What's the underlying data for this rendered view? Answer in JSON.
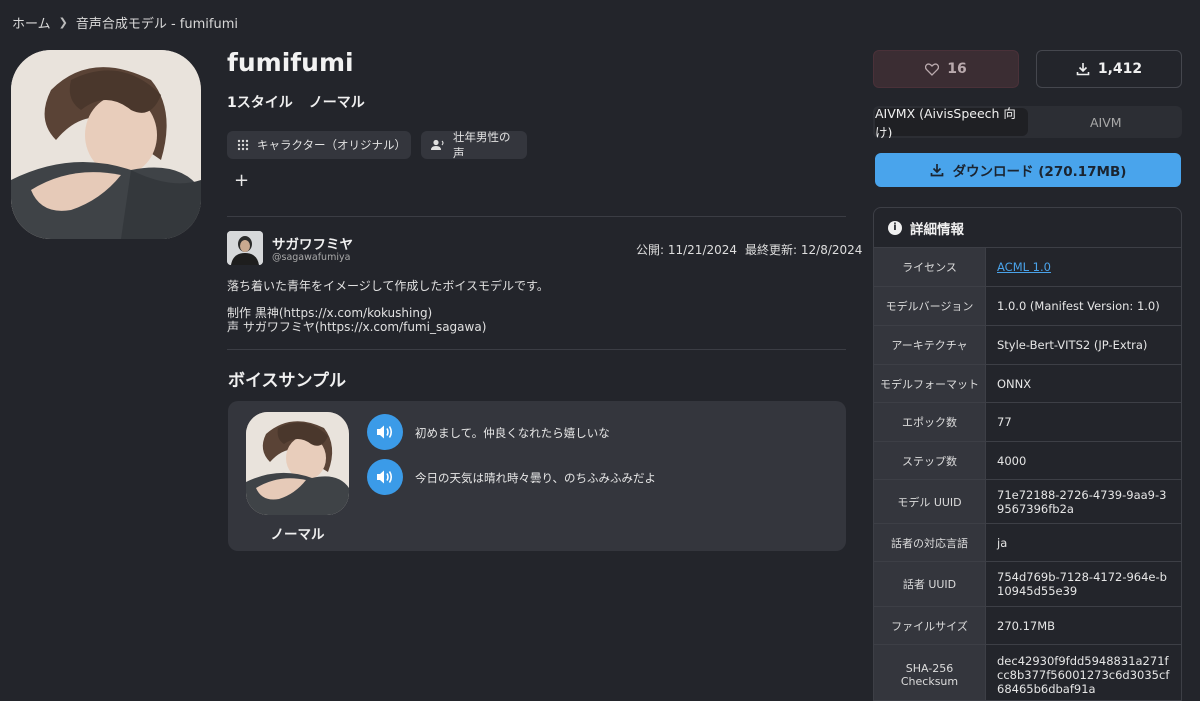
{
  "breadcrumb": {
    "home": "ホーム",
    "current": "音声合成モデル - fumifumi"
  },
  "model": {
    "name": "fumifumi",
    "style_count": "1スタイル",
    "style_name": "ノーマル",
    "tags": [
      "キャラクター（オリジナル）",
      "壮年男性の声"
    ],
    "add_tag": "+"
  },
  "author": {
    "name": "サガワフミヤ",
    "handle": "@sagawafumiya",
    "published": "公開: 11/21/2024",
    "updated": "最終更新: 12/8/2024"
  },
  "description": {
    "line1": "落ち着いた青年をイメージして作成したボイスモデルです。",
    "line2": "制作 黒神(https://x.com/kokushing)",
    "line3": "声 サガワフミヤ(https://x.com/fumi_sagawa)"
  },
  "voice_samples": {
    "title": "ボイスサンプル",
    "style_label": "ノーマル",
    "samples": [
      "初めまして。仲良くなれたら嬉しいな",
      "今日の天気は晴れ時々曇り、のちふみふみだよ"
    ]
  },
  "actions": {
    "likes": "16",
    "downloads": "1,412",
    "format_options": [
      "AIVMX (AivisSpeech 向け)",
      "AIVM"
    ],
    "format_selected": "AIVMX (AivisSpeech 向け)",
    "download_label": "ダウンロード (270.17MB)"
  },
  "details": {
    "title": "詳細情報",
    "rows": [
      {
        "key": "ライセンス",
        "value": "ACML 1.0"
      },
      {
        "key": "モデルバージョン",
        "value": "1.0.0 (Manifest Version: 1.0)"
      },
      {
        "key": "アーキテクチャ",
        "value": "Style-Bert-VITS2 (JP-Extra)"
      },
      {
        "key": "モデルフォーマット",
        "value": "ONNX"
      },
      {
        "key": "エポック数",
        "value": "77"
      },
      {
        "key": "ステップ数",
        "value": "4000"
      },
      {
        "key": "モデル UUID",
        "value": "71e72188-2726-4739-9aa9-39567396fb2a"
      },
      {
        "key": "話者の対応言語",
        "value": "ja"
      },
      {
        "key": "話者 UUID",
        "value": "754d769b-7128-4172-964e-b10945d55e39"
      },
      {
        "key": "ファイルサイズ",
        "value": "270.17MB"
      },
      {
        "key": "SHA-256 Checksum",
        "value": "dec42930f9fdd5948831a271fcc8b377f56001273c6d3035cf68465b6dbaf91a"
      }
    ]
  },
  "colors": {
    "background": "#23252b",
    "accent": "#49a4ec",
    "link": "#4aa3ea"
  }
}
